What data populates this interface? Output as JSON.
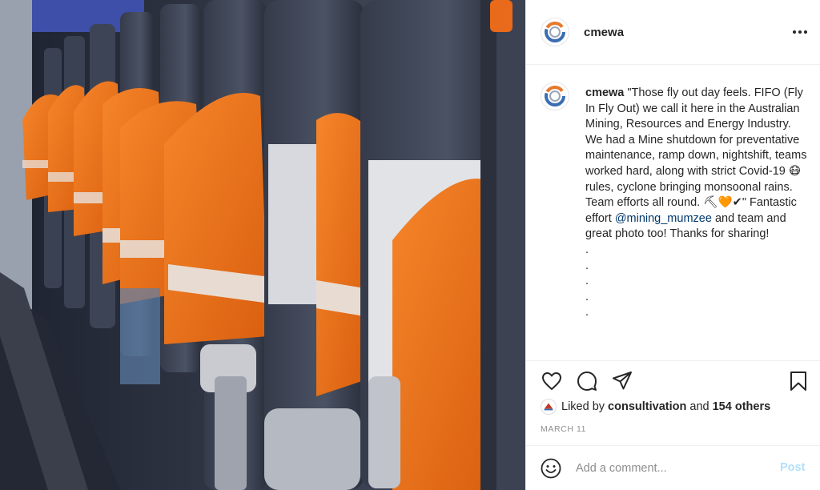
{
  "header": {
    "username": "cmewa",
    "more_icon": "more-horizontal-icon"
  },
  "photo": {
    "alt": "Workers in orange high-vis shirts seated on a plane",
    "colors": {
      "vest_orange": "#f0761c",
      "reflective_stripe": "#e8dcd2",
      "seat_blue": "#3e4556"
    }
  },
  "caption": {
    "username": "cmewa",
    "text_part1": "\"Those fly out day feels. FIFO (Fly In Fly Out) we call it here in the Australian Mining, Resources and Energy Industry. We had a Mine shutdown for preventative maintenance, ramp down, nightshift, teams worked hard, along with strict Covid-19 😷 rules, cyclone bringing monsoonal rains. Team efforts all round. ⛏🧡✔\" Fantastic effort ",
    "mention": "@mining_mumzee",
    "text_part2": " and team and great photo too! Thanks for sharing!",
    "dots": [
      ".",
      ".",
      ".",
      ".",
      "."
    ]
  },
  "actions": {
    "like_icon": "heart-icon",
    "comment_icon": "comment-icon",
    "share_icon": "share-icon",
    "save_icon": "bookmark-icon"
  },
  "likes": {
    "prefix": "Liked by",
    "user": "consultivation",
    "conjunction": "and",
    "others": "154 others"
  },
  "date": "MARCH 11",
  "comment_box": {
    "placeholder": "Add a comment...",
    "post_label": "Post",
    "emoji_icon": "smiley-icon"
  },
  "brand_colors": {
    "logo_blue": "#3a6db3",
    "logo_orange": "#e8782a",
    "link_blue": "#00376b",
    "post_disabled": "#b2dffc",
    "muted": "#8e8e8e"
  }
}
